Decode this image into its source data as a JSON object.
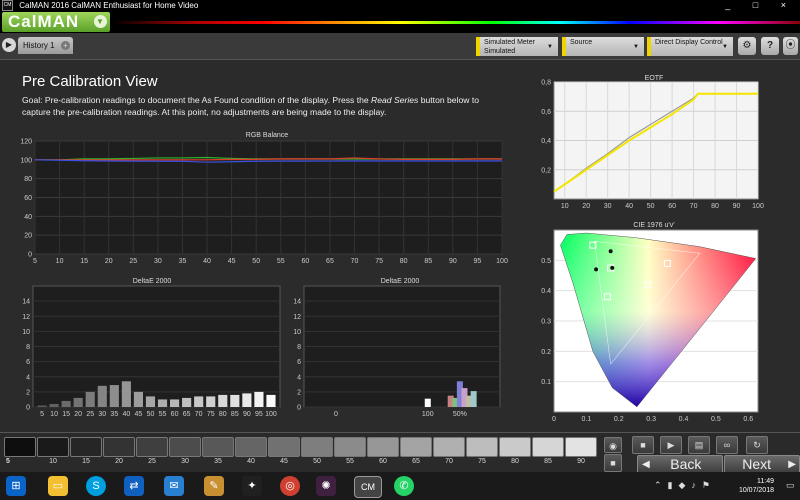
{
  "window": {
    "title": "CalMAN 2016 CalMAN Enthusiast for Home Video",
    "controls": [
      "_",
      "□",
      "×"
    ]
  },
  "brand": {
    "name": "CalMAN"
  },
  "tabs": [
    {
      "label": "History 1"
    }
  ],
  "toolbar": {
    "meter": {
      "line1": "Simulated Meter",
      "line2": "Simulated"
    },
    "source": {
      "label": "Source"
    },
    "display": {
      "label": "Direct Display Control"
    },
    "help_label": "?"
  },
  "page": {
    "title": "Pre Calibration View",
    "goal_pre": "Goal: Pre-calibration readings to document the As Found condition of the display. Press the ",
    "goal_em": "Read Series",
    "goal_post": " button below to capture the pre-calibration readings. At this point, no adjustments are being made to the display."
  },
  "chart_data": [
    {
      "type": "line",
      "title": "RGB Balance",
      "x": [
        5,
        10,
        15,
        20,
        25,
        30,
        35,
        40,
        45,
        50,
        55,
        60,
        65,
        70,
        75,
        80,
        85,
        90,
        95,
        100
      ],
      "ylim": [
        0,
        120
      ],
      "yticks": [
        0,
        20,
        40,
        60,
        80,
        100,
        120
      ],
      "series": [
        {
          "color": "#2db52d",
          "values": [
            100,
            100,
            101,
            101,
            101.5,
            102,
            102,
            102.5,
            101.5,
            101,
            101,
            101,
            101,
            101,
            101,
            101,
            101,
            101,
            101,
            101
          ]
        },
        {
          "color": "#e03a2a",
          "values": [
            100,
            100,
            100,
            100,
            100,
            100,
            100,
            100,
            100.5,
            100.5,
            101,
            101,
            101,
            102,
            101,
            100.5,
            100.5,
            100.5,
            101,
            101
          ]
        },
        {
          "color": "#3b4fe0",
          "values": [
            100,
            99.5,
            99,
            98.8,
            98.6,
            98.5,
            98.5,
            97.5,
            98,
            98.5,
            98.6,
            98.6,
            98.7,
            98.8,
            98.8,
            98.8,
            98.8,
            98.8,
            98.8,
            98.8
          ]
        }
      ]
    },
    {
      "type": "bar",
      "title": "DeltaE 2000",
      "categories": [
        "5",
        "10",
        "15",
        "20",
        "25",
        "30",
        "35",
        "40",
        "45",
        "50",
        "55",
        "60",
        "65",
        "70",
        "75",
        "80",
        "85",
        "90",
        "95",
        "100"
      ],
      "values": [
        0.2,
        0.4,
        0.8,
        1.2,
        2.0,
        2.8,
        2.9,
        3.4,
        2.0,
        1.4,
        1.0,
        1.0,
        1.2,
        1.4,
        1.4,
        1.6,
        1.6,
        1.8,
        2.0,
        1.6
      ],
      "ylim": [
        0,
        16
      ],
      "yticks": [
        0,
        2,
        4,
        6,
        8,
        10,
        12,
        14
      ]
    },
    {
      "type": "bar",
      "title": "DeltaE 2000",
      "xticks": [
        "0",
        "100",
        "50%"
      ],
      "bars": [
        {
          "x": 100,
          "value": 1.1,
          "color": "#ffffff"
        },
        {
          "x": 125,
          "value": 1.5,
          "color": "#c88080"
        },
        {
          "x": 130,
          "value": 1.2,
          "color": "#7fbf7f"
        },
        {
          "x": 135,
          "value": 3.4,
          "color": "#7f7fd8"
        },
        {
          "x": 140,
          "value": 2.5,
          "color": "#c8a0c8"
        },
        {
          "x": 145,
          "value": 1.5,
          "color": "#c0c0a0"
        },
        {
          "x": 150,
          "value": 2.1,
          "color": "#a0c8c8"
        }
      ],
      "ylim": [
        0,
        16
      ],
      "yticks": [
        0,
        2,
        4,
        6,
        8,
        10,
        12,
        14
      ]
    },
    {
      "type": "line",
      "title": "EOTF",
      "x": [
        5,
        10,
        20,
        30,
        40,
        50,
        60,
        70,
        72,
        80,
        90,
        100
      ],
      "xticks": [
        10,
        20,
        30,
        40,
        50,
        60,
        70,
        80,
        90,
        100
      ],
      "ylim": [
        0,
        0.8
      ],
      "yticks": [
        0.2,
        0.4,
        0.6,
        0.8
      ],
      "series": [
        {
          "color": "#f2e600",
          "values": [
            0.05,
            0.1,
            0.2,
            0.3,
            0.4,
            0.49,
            0.58,
            0.68,
            0.72,
            0.72,
            0.72,
            0.72
          ]
        },
        {
          "color": "#9a9a9a",
          "values": [
            0.05,
            0.1,
            0.21,
            0.31,
            0.42,
            0.51,
            0.6,
            0.69,
            0.72,
            0.72,
            0.72,
            0.72
          ]
        }
      ]
    },
    {
      "type": "scatter",
      "title": "CIE 1976 u'v'",
      "xlim": [
        0,
        0.63
      ],
      "ylim": [
        0,
        0.6
      ],
      "xticks": [
        0,
        0.1,
        0.2,
        0.3,
        0.4,
        0.5,
        0.6
      ],
      "yticks": [
        0.1,
        0.2,
        0.3,
        0.4,
        0.5
      ],
      "points": [
        {
          "u": 0.12,
          "v": 0.55,
          "kind": "target"
        },
        {
          "u": 0.13,
          "v": 0.47,
          "kind": "measured"
        },
        {
          "u": 0.175,
          "v": 0.53,
          "kind": "measured"
        },
        {
          "u": 0.175,
          "v": 0.475,
          "kind": "target"
        },
        {
          "u": 0.18,
          "v": 0.475,
          "kind": "measured"
        },
        {
          "u": 0.35,
          "v": 0.49,
          "kind": "target"
        },
        {
          "u": 0.29,
          "v": 0.42,
          "kind": "target"
        },
        {
          "u": 0.165,
          "v": 0.38,
          "kind": "target"
        }
      ]
    }
  ],
  "swatches": [
    {
      "label": "5",
      "color": "#0e0e0e"
    },
    {
      "label": "10",
      "color": "#1a1a1a"
    },
    {
      "label": "15",
      "color": "#262626"
    },
    {
      "label": "20",
      "color": "#333333"
    },
    {
      "label": "25",
      "color": "#3f3f3f"
    },
    {
      "label": "30",
      "color": "#4c4c4c"
    },
    {
      "label": "35",
      "color": "#585858"
    },
    {
      "label": "40",
      "color": "#656565"
    },
    {
      "label": "45",
      "color": "#717171"
    },
    {
      "label": "50",
      "color": "#7e7e7e"
    },
    {
      "label": "55",
      "color": "#8b8b8b"
    },
    {
      "label": "60",
      "color": "#979797"
    },
    {
      "label": "65",
      "color": "#a4a4a4"
    },
    {
      "label": "70",
      "color": "#b0b0b0"
    },
    {
      "label": "75",
      "color": "#bdbdbd"
    },
    {
      "label": "80",
      "color": "#cacaca"
    },
    {
      "label": "85",
      "color": "#d6d6d6"
    },
    {
      "label": "90",
      "color": "#e3e3e3"
    }
  ],
  "nav": {
    "back": "Back",
    "next": "Next"
  },
  "taskbar": {
    "time": "11:49",
    "date": "10/07/2018"
  }
}
